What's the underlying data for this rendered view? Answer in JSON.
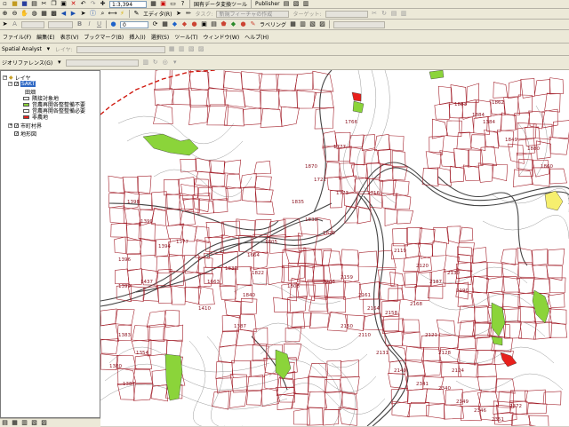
{
  "toolbar1": {
    "scale": "1:3,394",
    "publisher_menu": "Publisher",
    "tools_label": "国有データ変換ツール",
    "editor_label": "エディタ(R)",
    "task_label": "タスク:",
    "task_value": "新規フィーチャの作成",
    "target_label": "ターゲット:"
  },
  "toolbar2": {
    "zoom_pct": "0",
    "labeling_label": "ラベリング"
  },
  "menubar": {
    "items": [
      "ファイル(F)",
      "編集(E)",
      "表示(V)",
      "ブックマーク(B)",
      "挿入(I)",
      "選択(S)",
      "ツール(T)",
      "ウィンドウ(W)",
      "ヘルプ(H)"
    ]
  },
  "spatial_analyst": {
    "label": "Spatial Analyst",
    "layer_label": "レイヤ:"
  },
  "georef": {
    "label": "ジオリファレンス(G)"
  },
  "toc": {
    "root": "レイヤ",
    "group": "SAKT",
    "sublayer": "田畑",
    "legend": [
      {
        "label": "隣接対象地",
        "color": "#ffffff"
      },
      {
        "label": "営農再開各整整備不要",
        "color": "#8bd43a"
      },
      {
        "label": "営農再開各整整備必要",
        "color": "#ffffff"
      },
      {
        "label": "非農地",
        "color": "#e8201c"
      }
    ],
    "layer2": "市町村界",
    "layer3": "地形図"
  },
  "colors": {
    "parcel_line": "#a3202b",
    "boundary_dash": "#d01a10",
    "farmland_green": "#8bd43a",
    "nonfarm_red": "#e8201c",
    "highlight_yellow": "#f6ef6e"
  },
  "map_labels": [
    "1883",
    "1884",
    "1862",
    "1777",
    "1766",
    "1716",
    "1773",
    "1835",
    "1838",
    "1398",
    "1390",
    "1394",
    "1377",
    "1396",
    "1399",
    "1437",
    "1664",
    "1808",
    "1663",
    "1840",
    "1410",
    "1387",
    "2119",
    "2120",
    "2187",
    "2130",
    "2190",
    "2168",
    "2121",
    "2128",
    "2124",
    "2206",
    "2159",
    "2161",
    "2164",
    "2158",
    "2150",
    "2110",
    "2131",
    "2140",
    "2341",
    "2340",
    "2349",
    "2346",
    "2351",
    "2372",
    "1383",
    "1354",
    "1380",
    "1387",
    "1384",
    "1849",
    "1880",
    "1860",
    "1870",
    "1722",
    "1829",
    "1822",
    "1839",
    "1805"
  ]
}
